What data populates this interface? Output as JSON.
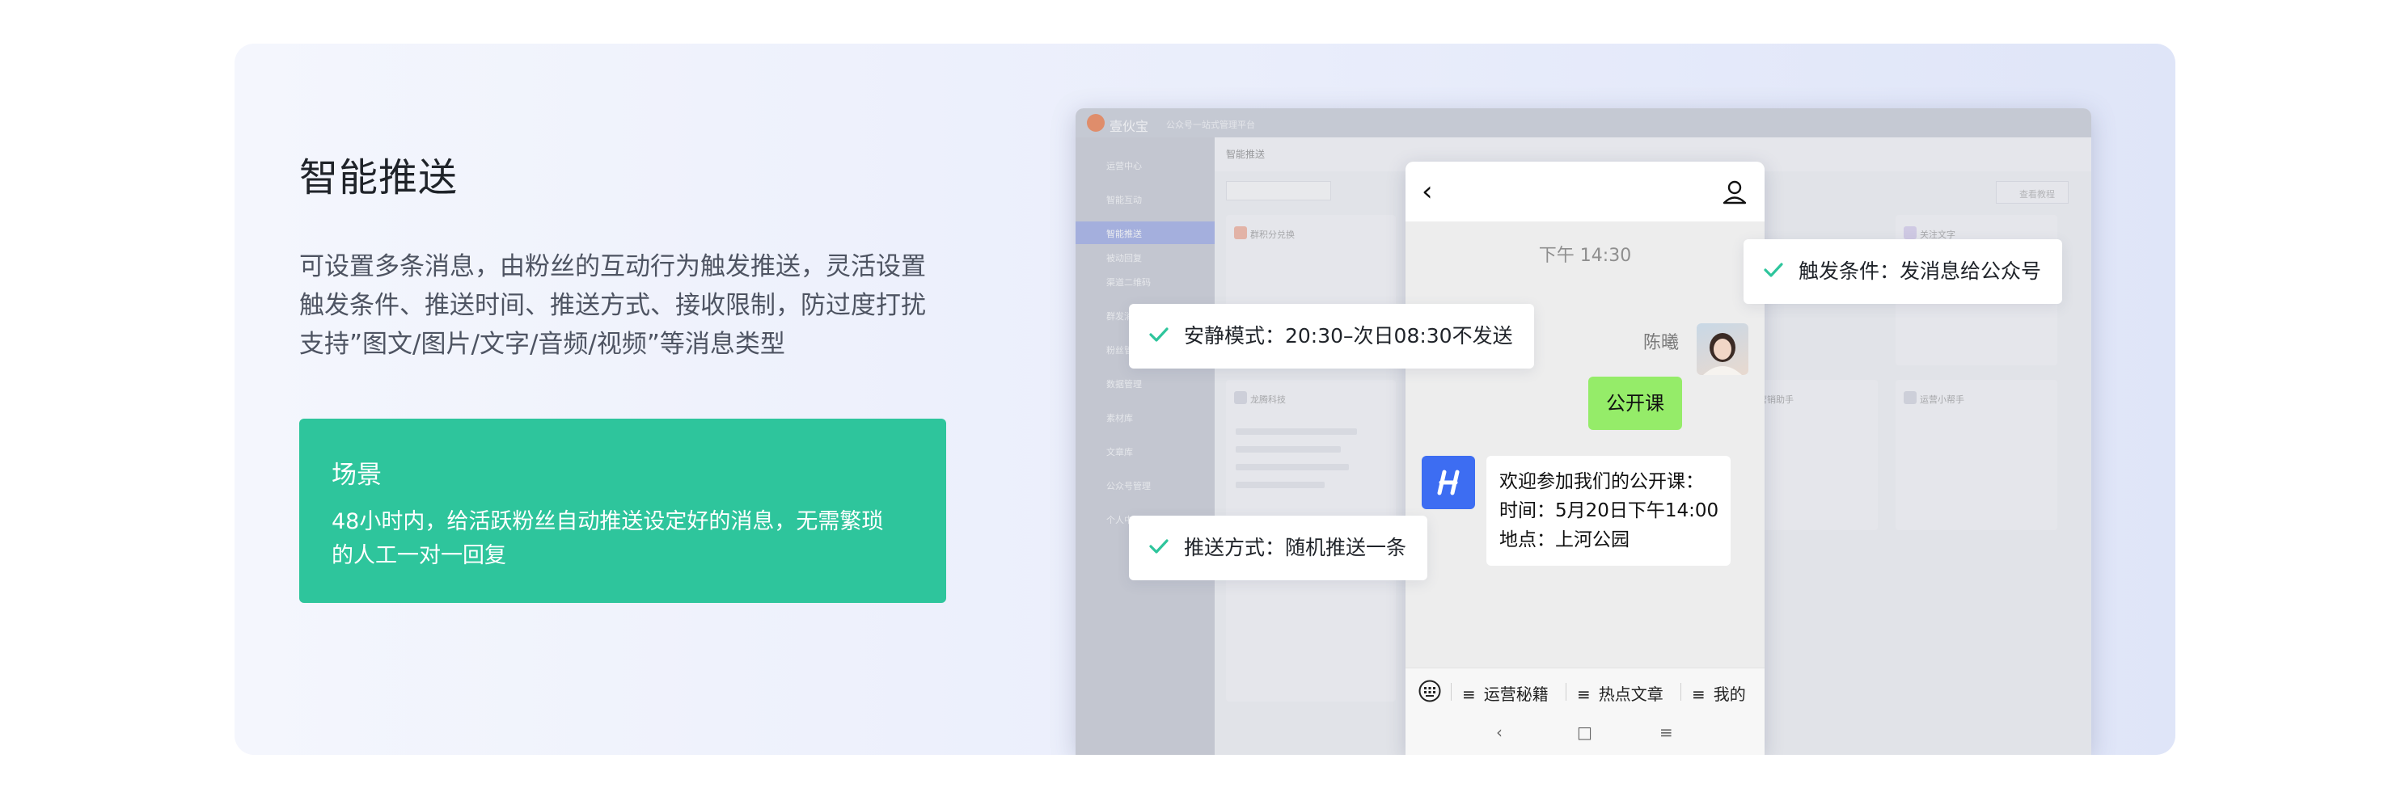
{
  "section": {
    "title": "智能推送",
    "desc_lines": [
      "可设置多条消息，由粉丝的互动行为触发推送，灵活设置",
      "触发条件、推送时间、推送方式、接收限制，防过度打扰",
      "支持”图文/图片/文字/音频/视频”等消息类型"
    ]
  },
  "scene": {
    "title": "场景",
    "lines": [
      "48小时内，给活跃粉丝自动推送设定好的消息，无需繁琐",
      "的人工一对一回复"
    ]
  },
  "dashboard": {
    "brand": "壹伙宝",
    "subtitle": "公众号一站式管理平台",
    "header": "智能推送",
    "button": "查看教程",
    "sidebar": [
      "运营中心",
      "智能互动",
      "智能推送",
      "被动回复",
      "渠道二维码",
      "群发消息",
      "粉丝管理",
      "数据管理",
      "素材库",
      "文章库",
      "公众号管理",
      "个人中心"
    ],
    "cards": [
      "群积分兑换",
      "关注文字",
      "龙腾科技",
      "微信营销助手",
      "运营小帮手",
      "运营小帮手"
    ]
  },
  "phone": {
    "time": "下午 14:30",
    "sender": "陈曦",
    "user_message": "公开课",
    "bot_lines": [
      "欢迎参加我们的公开课：",
      "时间：5月20日下午14:00",
      "地点：上河公园"
    ],
    "menu": [
      "运营秘籍",
      "热点文章",
      "我的"
    ],
    "nav": [
      "‹",
      "□",
      "≡"
    ]
  },
  "callouts": {
    "trigger": "触发条件：发消息给公众号",
    "quiet": "安静模式：20:30–次日08:30不发送",
    "method": "推送方式：随机推送一条"
  },
  "colors": {
    "accent_green": "#2ec59c",
    "bubble_green": "#95ec69",
    "bot_blue": "#3d6df2"
  }
}
